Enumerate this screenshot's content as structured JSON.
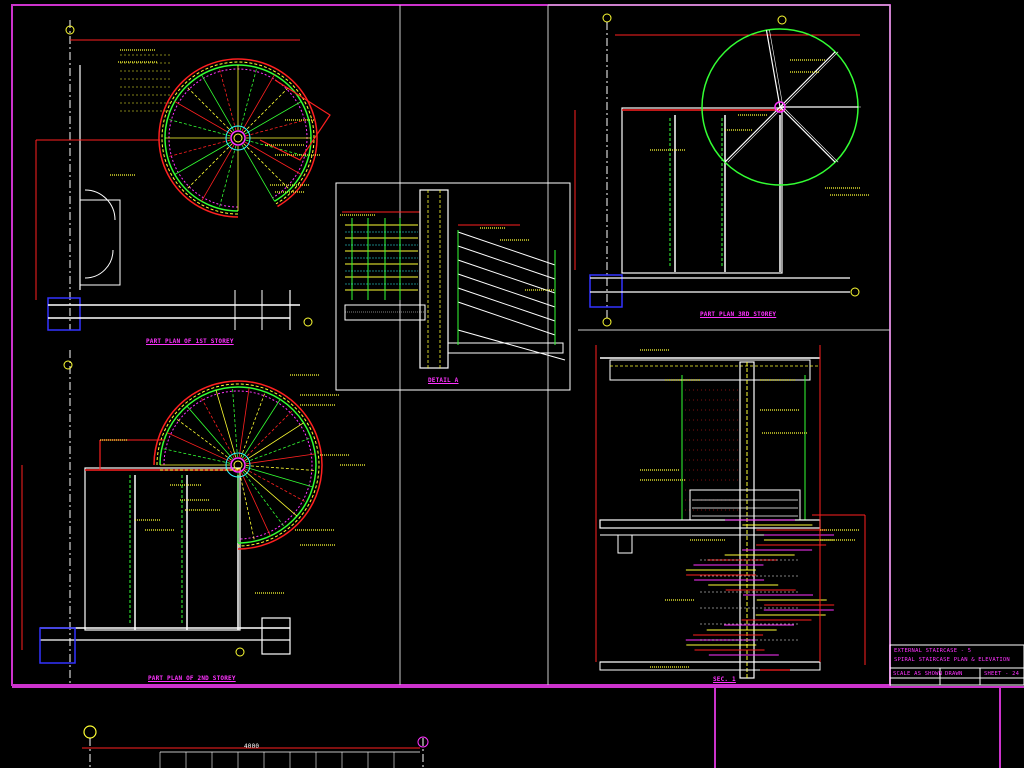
{
  "drawing": {
    "plan_1st_storey": "PART PLAN OF 1ST STOREY",
    "plan_2nd_storey": "PART PLAN OF 2ND STOREY",
    "plan_3rd_storey": "PART PLAN 3RD STOREY",
    "detail_label": "DETAIL A",
    "section_label": "SEC. 1"
  },
  "dimensions": {
    "bottom_span": "4000"
  },
  "title_block": {
    "line1": "EXTERNAL STAIRCASE - 5",
    "line2": "SPIRAL STAIRCASE PLAN & ELEVATION",
    "scale": "SCALE   AS SHOWN",
    "drawn": "DRAWN",
    "sheet": "SHEET - 24"
  },
  "colors": {
    "background": "#000000",
    "frame": "#cc33cc",
    "grid": "#ffffff",
    "red": "#ff2020",
    "yellow": "#ffff33",
    "green": "#33ff33",
    "cyan": "#33ffff",
    "magenta": "#ff33ff",
    "blue": "#3333ff"
  }
}
